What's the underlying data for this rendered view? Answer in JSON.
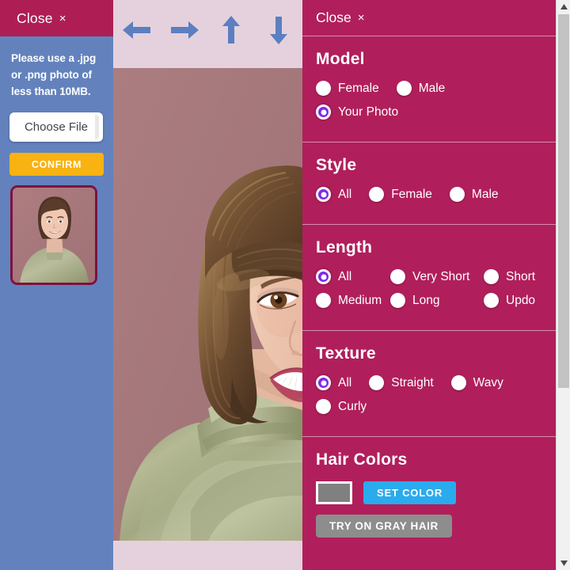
{
  "upload_panel": {
    "close_label": "Close",
    "close_x": "×",
    "hint": "Please use a .jpg or .png photo of less than 10MB.",
    "choose_file_label": "Choose File",
    "confirm_label": "CONFIRM",
    "thumbnail_alt": "uploaded-user-photo"
  },
  "toolbar": {
    "arrows": [
      {
        "name": "arrow-left",
        "glyph": "left"
      },
      {
        "name": "arrow-right",
        "glyph": "right"
      },
      {
        "name": "arrow-up",
        "glyph": "up"
      },
      {
        "name": "arrow-down",
        "glyph": "down"
      }
    ],
    "arrow_color": "#5b7fc0"
  },
  "options_panel": {
    "close_label": "Close",
    "close_x": "×",
    "accent_color": "#b01f5b",
    "radio_selected_color": "#7d2ae8",
    "sections": {
      "model": {
        "title": "Model",
        "options": [
          {
            "label": "Female",
            "selected": false
          },
          {
            "label": "Male",
            "selected": false
          },
          {
            "label": "Your Photo",
            "selected": true
          }
        ]
      },
      "style": {
        "title": "Style",
        "options": [
          {
            "label": "All",
            "selected": true
          },
          {
            "label": "Female",
            "selected": false
          },
          {
            "label": "Male",
            "selected": false
          }
        ]
      },
      "length": {
        "title": "Length",
        "options": [
          {
            "label": "All",
            "selected": true
          },
          {
            "label": "Very Short",
            "selected": false
          },
          {
            "label": "Short",
            "selected": false
          },
          {
            "label": "Medium",
            "selected": false
          },
          {
            "label": "Long",
            "selected": false
          },
          {
            "label": "Updo",
            "selected": false
          }
        ]
      },
      "texture": {
        "title": "Texture",
        "options": [
          {
            "label": "All",
            "selected": true
          },
          {
            "label": "Straight",
            "selected": false
          },
          {
            "label": "Wavy",
            "selected": false
          },
          {
            "label": "Curly",
            "selected": false
          }
        ]
      },
      "hair_colors": {
        "title": "Hair Colors",
        "swatch_color": "#808080",
        "set_color_label": "SET COLOR",
        "gray_hair_label": "TRY ON GRAY HAIR"
      }
    }
  },
  "scrollbar": {
    "up_arrow": "▲",
    "down_arrow": "▼"
  }
}
